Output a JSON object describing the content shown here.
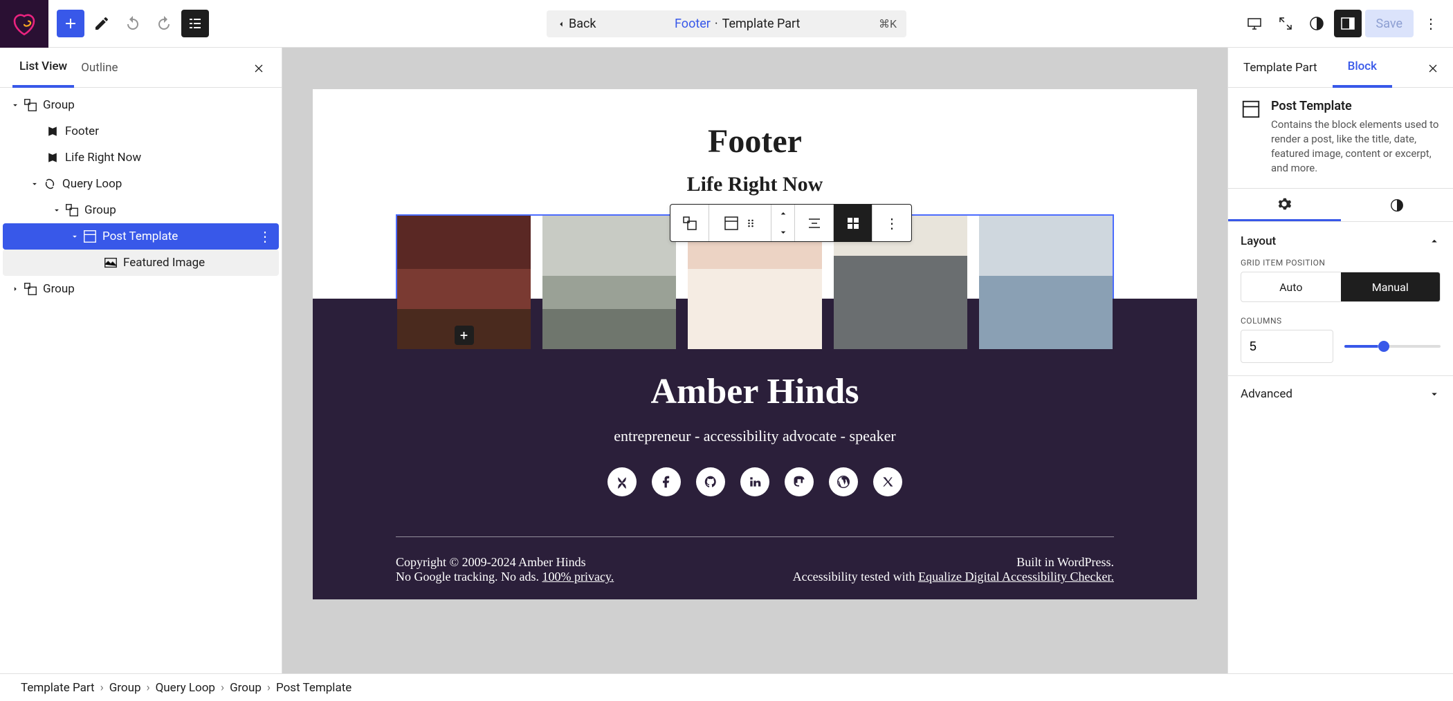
{
  "topbar": {
    "back_label": "Back",
    "title_link": "Footer",
    "title_suffix": "Template Part",
    "shortcut": "⌘K",
    "save_label": "Save"
  },
  "left_panel": {
    "tab_list_view": "List View",
    "tab_outline": "Outline",
    "tree": {
      "group1": "Group",
      "footer": "Footer",
      "life_right_now": "Life Right Now",
      "query_loop": "Query Loop",
      "group2": "Group",
      "post_template": "Post Template",
      "featured_image": "Featured Image",
      "group3": "Group"
    }
  },
  "canvas": {
    "h1": "Footer",
    "h2": "Life Right Now",
    "dark_footer": {
      "name": "Amber Hinds",
      "tagline": "entrepreneur - accessibility advocate - speaker",
      "copyright": "Copyright © 2009-2024 Amber Hinds",
      "no_tracking_prefix": "No Google tracking. No ads. ",
      "privacy_link": "100% privacy.",
      "built_in": "Built in WordPress.",
      "a11y_prefix": "Accessibility tested with ",
      "a11y_link": "Equalize Digital Accessibility Checker."
    }
  },
  "right_panel": {
    "tab_template_part": "Template Part",
    "tab_block": "Block",
    "block_name": "Post Template",
    "block_desc": "Contains the block elements used to render a post, like the title, date, featured image, content or excerpt, and more.",
    "layout": {
      "title": "Layout",
      "grid_item_position_label": "GRID ITEM POSITION",
      "auto": "Auto",
      "manual": "Manual",
      "columns_label": "COLUMNS",
      "columns_value": "5"
    },
    "advanced": "Advanced"
  },
  "breadcrumb": [
    "Template Part",
    "Group",
    "Query Loop",
    "Group",
    "Post Template"
  ]
}
